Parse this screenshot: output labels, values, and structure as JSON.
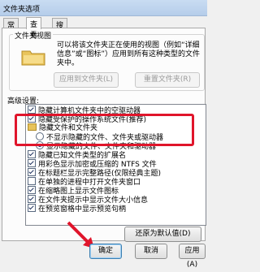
{
  "window": {
    "title": "文件夹选项"
  },
  "tabs": [
    {
      "label": "常规"
    },
    {
      "label": "查看"
    },
    {
      "label": "搜索"
    }
  ],
  "folder_views": {
    "title": "文件夹视图",
    "description": "可以将该文件夹正在使用的视图（例如“详细信息”或“图标”）应用到所有这种类型的文件夹中。",
    "apply_button": "应用到文件夹(L)",
    "reset_button": "重置文件夹(R)"
  },
  "advanced": {
    "label": "高级设置:",
    "items": [
      {
        "type": "checkbox",
        "checked": true,
        "label": "隐藏计算机文件夹中的空驱动器"
      },
      {
        "type": "checkbox",
        "checked": true,
        "label": "隐藏受保护的操作系统文件(推荐)"
      },
      {
        "type": "folder",
        "label": "隐藏文件和文件夹"
      },
      {
        "type": "radio",
        "checked": false,
        "label": "不显示隐藏的文件、文件夹或驱动器"
      },
      {
        "type": "radio",
        "checked": true,
        "label": "显示隐藏的文件、文件夹和驱动器"
      },
      {
        "type": "checkbox",
        "checked": true,
        "label": "隐藏已知文件类型的扩展名"
      },
      {
        "type": "checkbox",
        "checked": true,
        "label": "用彩色显示加密或压缩的 NTFS 文件"
      },
      {
        "type": "checkbox",
        "checked": true,
        "label": "在标题栏显示完整路径(仅限经典主题)"
      },
      {
        "type": "checkbox",
        "checked": false,
        "label": "在单独的进程中打开文件夹窗口"
      },
      {
        "type": "checkbox",
        "checked": true,
        "label": "在缩略图上显示文件图标"
      },
      {
        "type": "checkbox",
        "checked": true,
        "label": "在文件夹提示中显示文件大小信息"
      },
      {
        "type": "checkbox",
        "checked": true,
        "label": "在预览窗格中显示预览句柄"
      }
    ],
    "restore_button": "还原为默认值(D)"
  },
  "footer": {
    "ok": "确定",
    "cancel": "取消",
    "apply": "应用(A)"
  },
  "colors": {
    "highlight": "#e0152b"
  }
}
